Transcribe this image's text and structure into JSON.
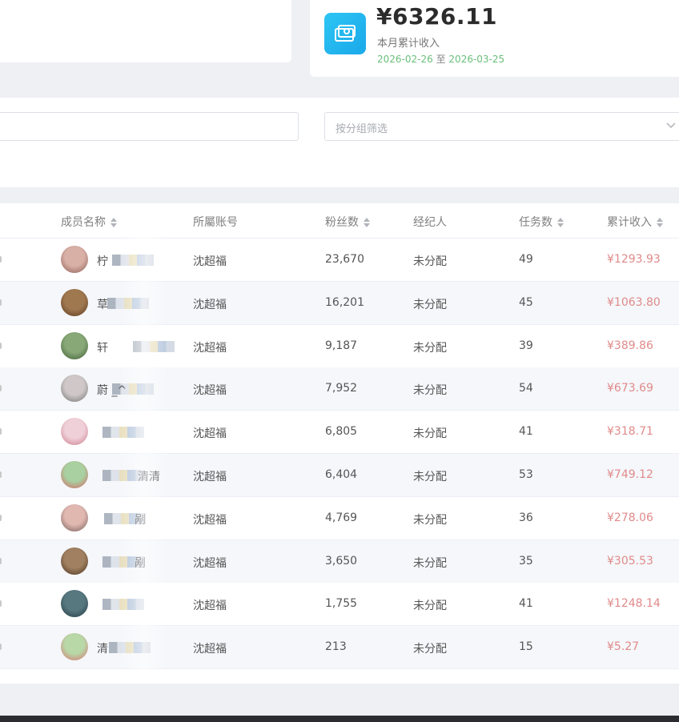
{
  "summary": {
    "income_amount": "¥6326.11",
    "income_label": "本月累计收入",
    "range_start": "2026-02-26",
    "range_sep": "至",
    "range_end": "2026-03-25"
  },
  "filters": {
    "search_value": "",
    "group_placeholder": "按分组筛选"
  },
  "table": {
    "columns": {
      "name": "成员名称",
      "account": "所屬账号",
      "fans": "粉丝数",
      "agent": "经纪人",
      "tasks": "任务数",
      "income": "累计收入"
    },
    "rows": [
      {
        "name": "柠",
        "account": "沈超福",
        "fans": "23,670",
        "agent": "未分配",
        "tasks": "49",
        "income": "¥1293.93"
      },
      {
        "name": "草",
        "account": "沈超福",
        "fans": "16,201",
        "agent": "未分配",
        "tasks": "45",
        "income": "¥1063.80"
      },
      {
        "name": "轩",
        "account": "沈超福",
        "fans": "9,187",
        "agent": "未分配",
        "tasks": "39",
        "income": "¥389.86"
      },
      {
        "name": "蔚 _^",
        "account": "沈超福",
        "fans": "7,952",
        "agent": "未分配",
        "tasks": "54",
        "income": "¥673.69"
      },
      {
        "name": "",
        "account": "沈超福",
        "fans": "6,805",
        "agent": "未分配",
        "tasks": "41",
        "income": "¥318.71"
      },
      {
        "name": "清清",
        "account": "沈超福",
        "fans": "6,404",
        "agent": "未分配",
        "tasks": "53",
        "income": "¥749.12"
      },
      {
        "name": "剐",
        "account": "沈超福",
        "fans": "4,769",
        "agent": "未分配",
        "tasks": "36",
        "income": "¥278.06"
      },
      {
        "name": "剐",
        "account": "沈超福",
        "fans": "3,650",
        "agent": "未分配",
        "tasks": "35",
        "income": "¥305.53"
      },
      {
        "name": "",
        "account": "沈超福",
        "fans": "1,755",
        "agent": "未分配",
        "tasks": "41",
        "income": "¥1248.14"
      },
      {
        "name": "清",
        "account": "沈超福",
        "fans": "213",
        "agent": "未分配",
        "tasks": "15",
        "income": "¥5.27"
      }
    ]
  },
  "colors": {
    "income_text": "#e08a8a",
    "range_text": "#6abf7b",
    "icon_bg": "#1fb3ee"
  }
}
